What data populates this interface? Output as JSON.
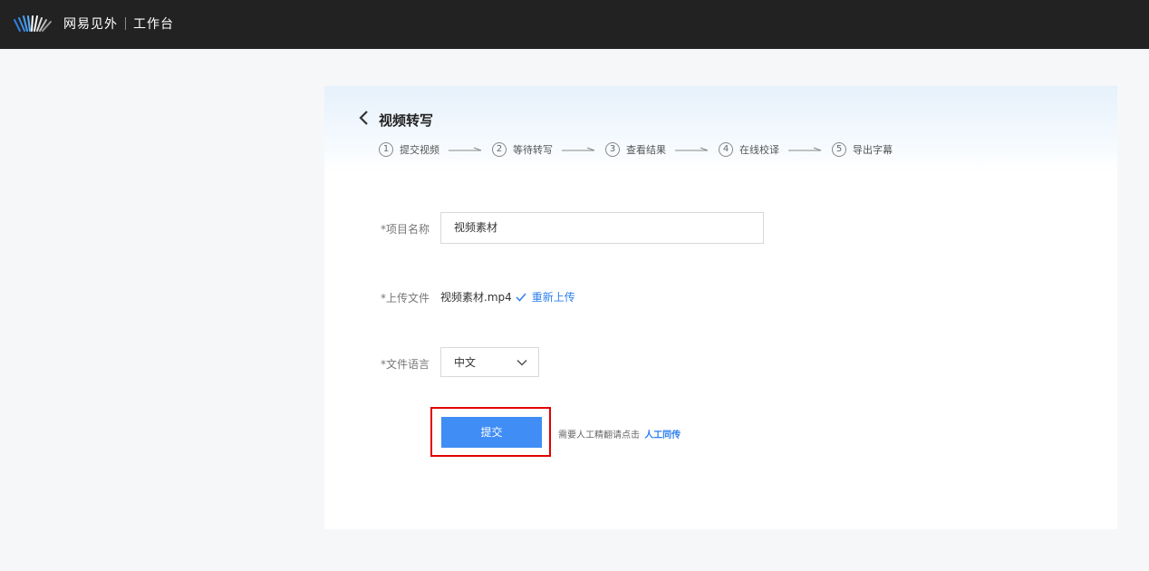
{
  "header": {
    "brand": "网易见外",
    "workspace": "工作台"
  },
  "page": {
    "title": "视频转写",
    "steps": [
      {
        "num": "1",
        "label": "提交视频"
      },
      {
        "num": "2",
        "label": "等待转写"
      },
      {
        "num": "3",
        "label": "查看结果"
      },
      {
        "num": "4",
        "label": "在线校译"
      },
      {
        "num": "5",
        "label": "导出字幕"
      }
    ]
  },
  "form": {
    "project_name_label": "*项目名称",
    "project_name_value": "视频素材",
    "upload_label": "*上传文件",
    "file_name": "视频素材.mp4",
    "reupload_link": "重新上传",
    "language_label": "*文件语言",
    "language_value": "中文",
    "submit_label": "提交",
    "human_hint": "需要人工精翻请点击",
    "human_link": "人工同传"
  },
  "colors": {
    "topbar": "#222222",
    "accent": "#3f8df5",
    "link": "#2d7ff0",
    "highlight": "#e00000"
  }
}
